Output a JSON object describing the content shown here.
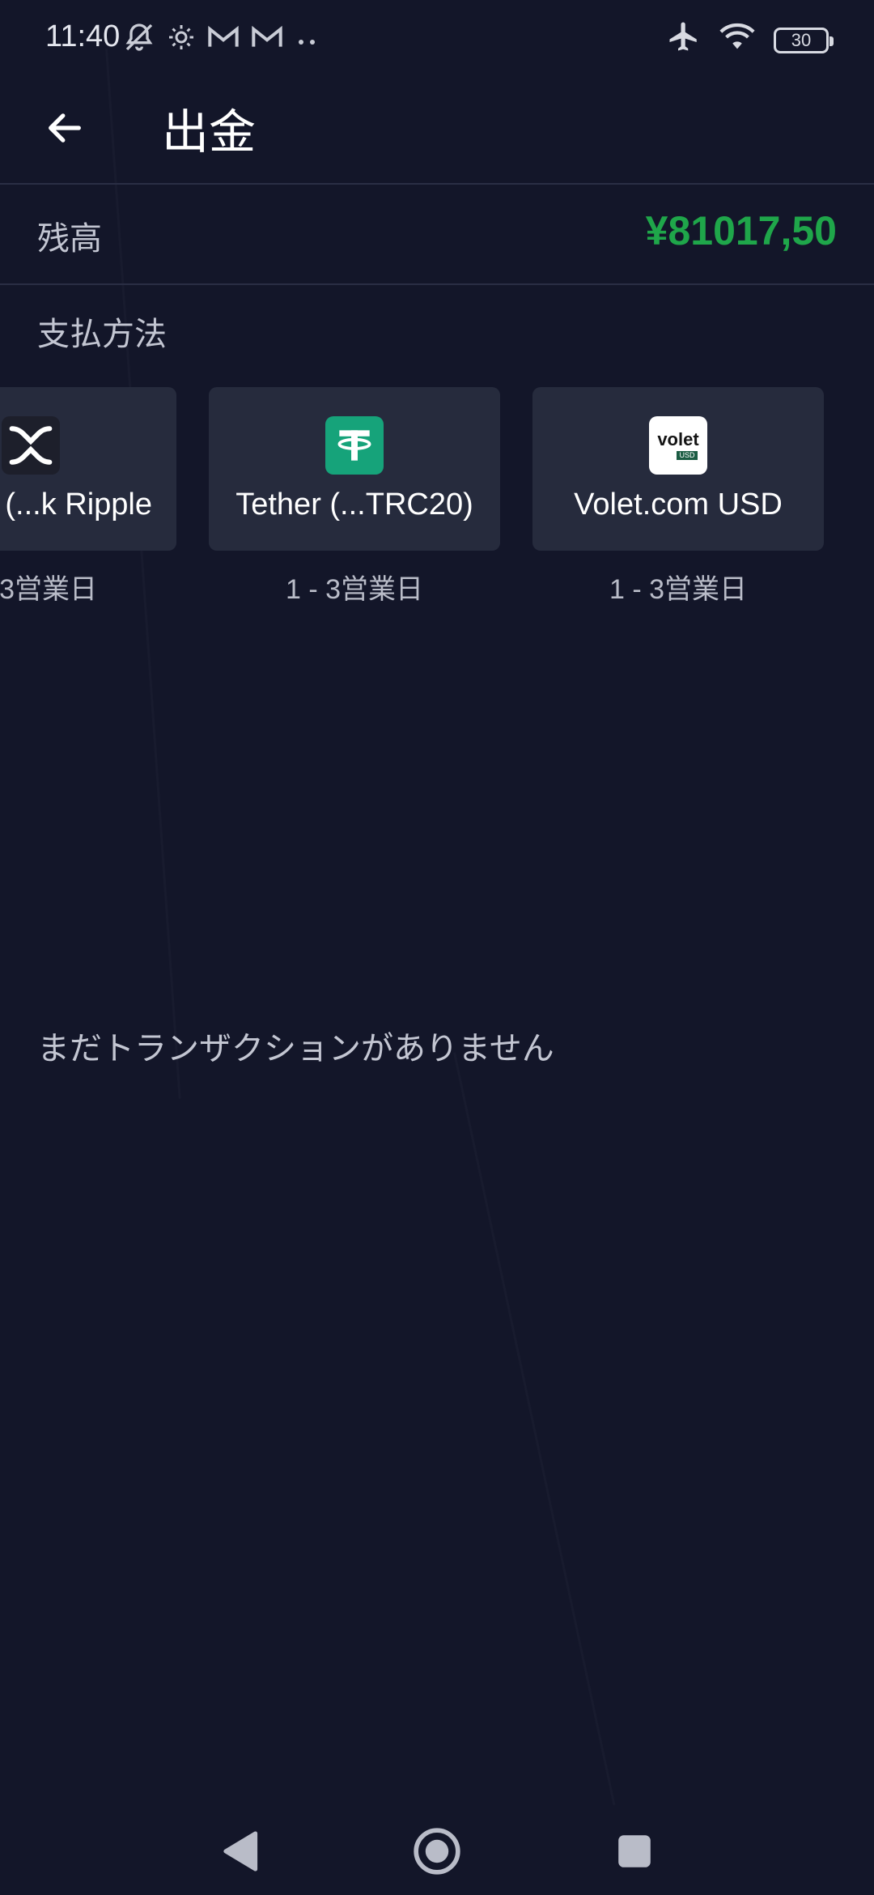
{
  "status_bar": {
    "time": "11:40",
    "battery": "30",
    "icons": [
      "bell-off-icon",
      "brightness-icon",
      "gmail-icon",
      "gmail-icon",
      "more-dots-icon",
      "airplane-icon",
      "wifi-icon",
      "battery-icon"
    ]
  },
  "header": {
    "title": "出金",
    "back_icon": "arrow-left-icon"
  },
  "balance": {
    "label": "残高",
    "value": "¥81017,50",
    "color": "#1fa64a"
  },
  "payment_section": {
    "label": "支払方法",
    "methods": [
      {
        "name": "(...k Ripple",
        "time": "3営業日",
        "icon": "ripple-xrp-icon",
        "icon_bg": "#1d1f2b"
      },
      {
        "name": "Tether (...TRC20)",
        "time": "1 - 3営業日",
        "icon": "tether-icon",
        "icon_bg": "#16a37a"
      },
      {
        "name": "Volet.com USD",
        "time": "1 - 3営業日",
        "icon": "volet-logo-icon",
        "icon_bg": "#ffffff"
      }
    ]
  },
  "volet_logo": {
    "word": "volet",
    "badge": "USD"
  },
  "empty_state": "まだトランザクションがありません",
  "nav": {
    "icons": [
      "back-triangle-icon",
      "home-circle-icon",
      "recents-square-icon"
    ]
  },
  "colors": {
    "background": "#131629",
    "card": "#262b3d",
    "accent_green": "#1fa64a"
  }
}
